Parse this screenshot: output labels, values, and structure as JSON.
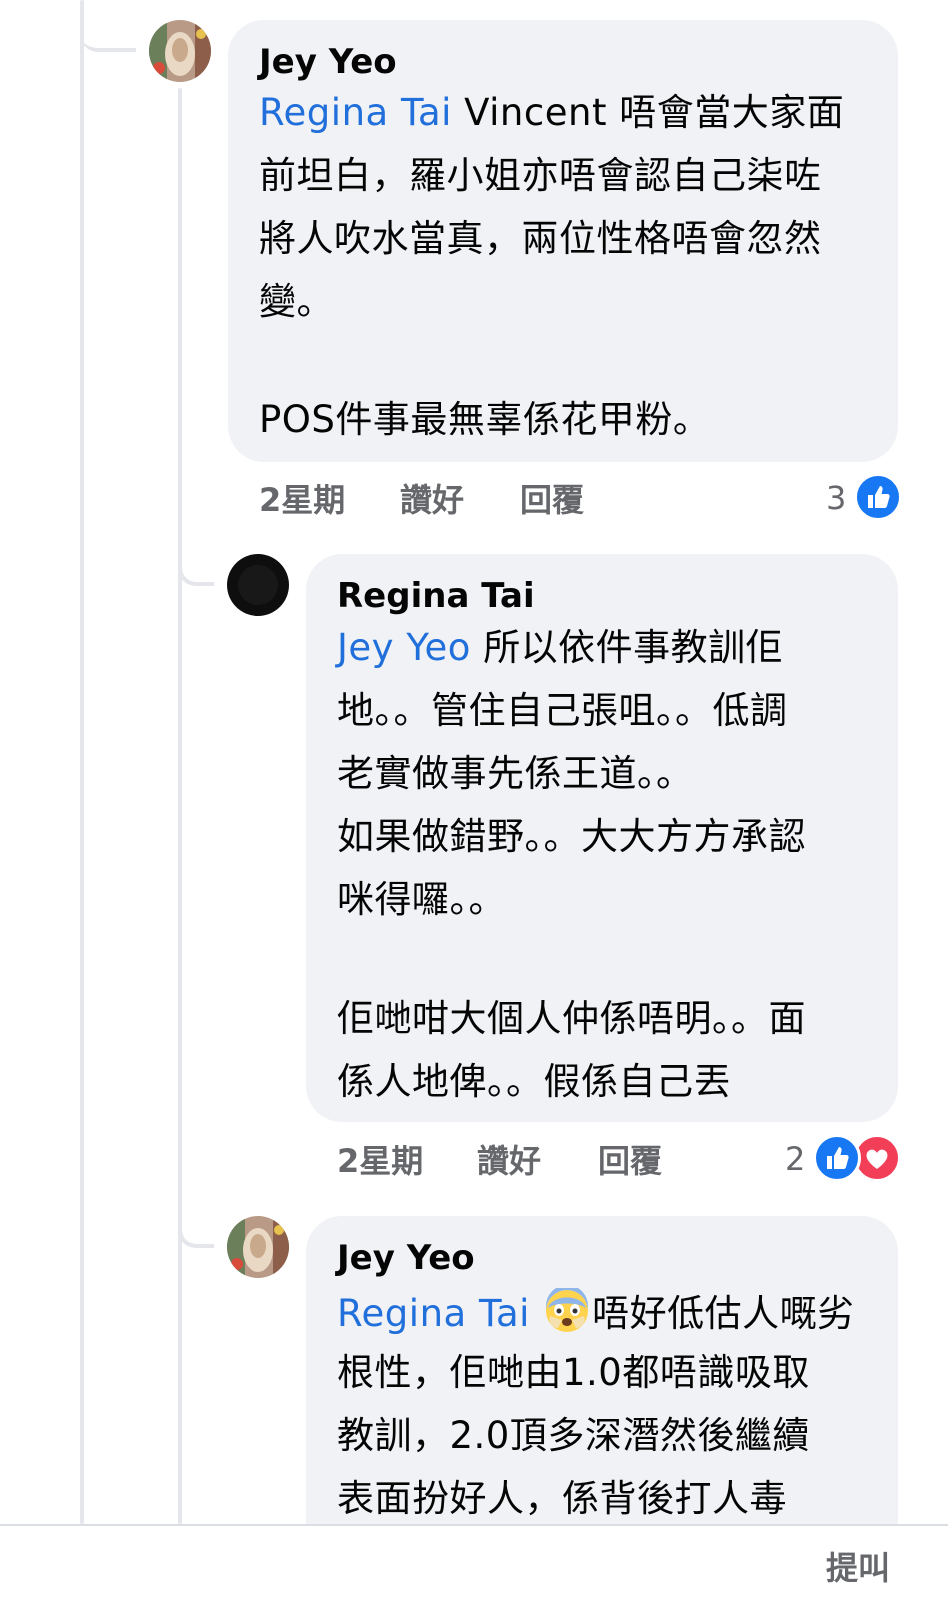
{
  "comments": [
    {
      "author": "Jey Yeo",
      "mention": "Regina Tai",
      "lines": [
        "Vincent 唔會當大家面",
        "前坦白，羅小姐亦唔會認自己柒咗",
        "將人吹水當真，兩位性格唔會忽然",
        "變。",
        "POS件事最無辜係花甲粉。"
      ],
      "time": "2星期",
      "like_label": "讚好",
      "reply_label": "回覆",
      "reaction_count": "3",
      "reactions": [
        "like-icon"
      ]
    },
    {
      "author": "Regina Tai",
      "mention": "Jey Yeo",
      "lines": [
        "所以依件事教訓佢",
        "地。。管住自己張咀。。低調",
        "老實做事先係王道。。",
        "如果做錯野。。大大方方承認",
        "咪得囉。。",
        "佢哋咁大個人仲係唔明。。面",
        "係人地俾。。假係自己丟"
      ],
      "time": "2星期",
      "like_label": "讚好",
      "reply_label": "回覆",
      "reaction_count": "2",
      "reactions": [
        "like-icon",
        "love-icon"
      ]
    },
    {
      "author": "Jey Yeo",
      "mention": "Regina Tai",
      "emoji": "fearful-face-emoji",
      "lines": [
        "唔好低估人嘅劣",
        "根性，佢哋由1.0都唔識吸取",
        "教訓，2.0頂多深潛然後繼續",
        "表面扮好人，係背後打人毒"
      ]
    }
  ],
  "bottom_bar": {
    "label": "提叫"
  },
  "colors": {
    "bubble": "#f0f2f5",
    "mention": "#216fdb",
    "meta": "#65676b",
    "like": "#1877f2",
    "love": "#f33e58"
  }
}
